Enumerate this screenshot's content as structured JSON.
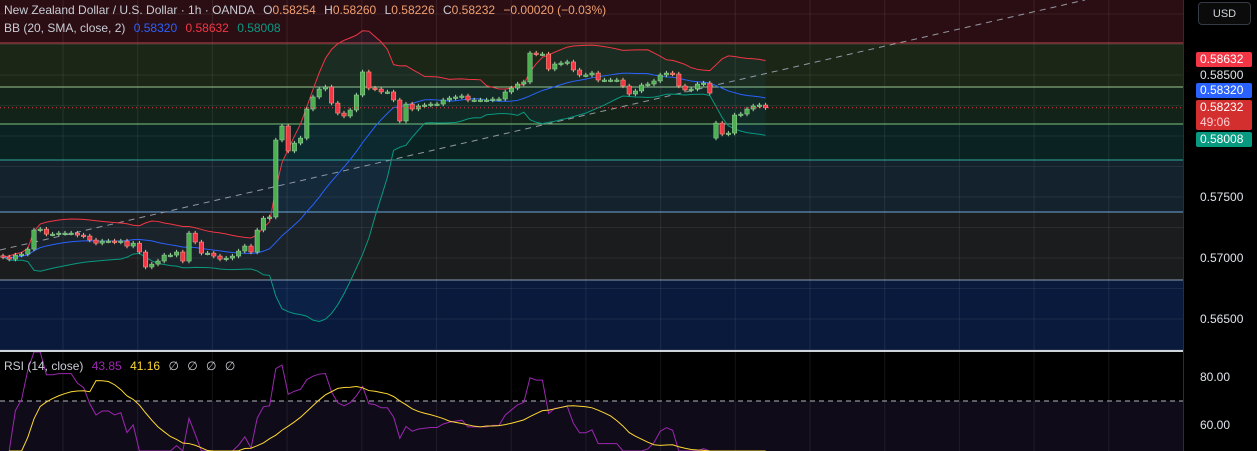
{
  "header": {
    "symbol_title": "New Zealand Dollar / U.S. Dollar · 1h · OANDA",
    "open_label": "O",
    "open": "0.58254",
    "high_label": "H",
    "high": "0.58260",
    "low_label": "L",
    "low": "0.58226",
    "close_label": "C",
    "close": "0.58232",
    "change": "−0.00020 (−0.03%)"
  },
  "bb_legend": {
    "label": "BB (20, SMA, close, 2)",
    "basis": "0.58320",
    "upper": "0.58632",
    "lower": "0.58008"
  },
  "rsi_legend": {
    "label": "RSI (14, close)",
    "rsi": "43.85",
    "ma": "41.16",
    "empty1": "∅",
    "empty2": "∅",
    "empty3": "∅",
    "empty4": "∅"
  },
  "axis": {
    "currency_button": "USD",
    "upper_band_tag": "0.58632",
    "tick_0585": "0.58500",
    "basis_tag": "0.58320",
    "last_price_tag": "0.58232",
    "countdown": "49:06",
    "lower_band_tag": "0.58008",
    "tick_0575": "0.57500",
    "tick_0570": "0.57000",
    "tick_0565": "0.56500",
    "rsi_tick_80": "80.00",
    "rsi_tick_60": "60.00"
  },
  "colors": {
    "up": "#4caf50",
    "down": "#f23645",
    "basis": "#2962ff",
    "upper": "#f23645",
    "lower": "#089981",
    "rsi": "#9c27b0",
    "rsi_ma": "#fdd835"
  },
  "chart_data": {
    "type": "candlestick",
    "title": "New Zealand Dollar / U.S. Dollar · 1h · OANDA",
    "ylabel": "USD",
    "ylim": [
      0.5625,
      0.5885
    ],
    "yticks": [
      0.565,
      0.57,
      0.575,
      0.585
    ],
    "grid": true,
    "close": [
      0.57008,
      0.56991,
      0.57024,
      0.57032,
      0.57073,
      0.57229,
      0.57237,
      0.57196,
      0.57196,
      0.57204,
      0.57204,
      0.57204,
      0.57188,
      0.5718,
      0.57147,
      0.57122,
      0.57139,
      0.57139,
      0.57131,
      0.57139,
      0.57098,
      0.57122,
      0.57049,
      0.56926,
      0.5695,
      0.56975,
      0.57024,
      0.57024,
      0.57049,
      0.56975,
      0.57204,
      0.57131,
      0.5704,
      0.5704,
      0.57016,
      0.56991,
      0.56999,
      0.57016,
      0.57057,
      0.57098,
      0.57049,
      0.57229,
      0.57327,
      0.57336,
      0.57967,
      0.58082,
      0.57877,
      0.57942,
      0.57983,
      0.58221,
      0.5832,
      0.58385,
      0.58402,
      0.5827,
      0.58188,
      0.58164,
      0.58213,
      0.58336,
      0.58525,
      0.58393,
      0.58385,
      0.58361,
      0.58361,
      0.58295,
      0.58123,
      0.58262,
      0.58221,
      0.58246,
      0.58254,
      0.58262,
      0.58262,
      0.58295,
      0.58311,
      0.5832,
      0.58328,
      0.58295,
      0.58295,
      0.58295,
      0.58295,
      0.58303,
      0.58303,
      0.58361,
      0.58393,
      0.58426,
      0.58443,
      0.5868,
      0.58672,
      0.58672,
      0.58549,
      0.5859,
      0.58598,
      0.58607,
      0.58541,
      0.585,
      0.585,
      0.58516,
      0.58459,
      0.58459,
      0.58459,
      0.58459,
      0.5841,
      0.58344,
      0.58369,
      0.58418,
      0.58426,
      0.58451,
      0.585,
      0.58516,
      0.58508,
      0.5841,
      0.58377,
      0.58385,
      0.58426,
      0.58434,
      0.58352,
      0.58106,
      0.58016,
      0.58024,
      0.58172,
      0.5818,
      0.58221,
      0.58246,
      0.58254,
      0.58232
    ],
    "open_overrides": {
      "115": 0.57983,
      "123": 0.58254
    },
    "indicators": {
      "bollinger": {
        "length": 20,
        "mult": 2,
        "last_basis": 0.5832,
        "last_upper": 0.58632,
        "last_lower": 0.58008
      },
      "rsi": {
        "length": 14,
        "last": 43.85,
        "ma_last": 41.16,
        "levels": [
          70,
          80,
          60
        ]
      }
    }
  }
}
